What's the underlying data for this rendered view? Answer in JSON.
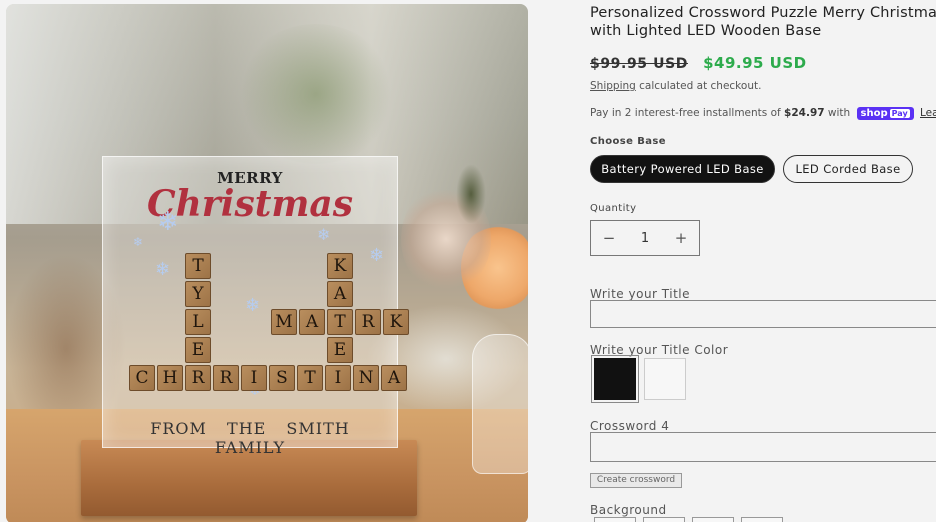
{
  "product": {
    "title_line1": "Personalized Crossword Puzzle Merry Christmas",
    "title_line2": "with Lighted LED Wooden Base",
    "price_regular": "$99.95 USD",
    "price_sale": "$49.95 USD",
    "shipping_link": "Shipping",
    "shipping_text": " calculated at checkout.",
    "installments_prefix": "Pay in 2 interest-free installments of ",
    "installments_amount": "$24.97",
    "installments_with": " with ",
    "shoppay_shop": "shop",
    "shoppay_pay": "Pay",
    "learn_more": "Learn more"
  },
  "options": {
    "base_label": "Choose Base",
    "base_options": [
      "Battery Powered LED Base",
      "LED Corded Base"
    ],
    "base_selected": "Battery Powered LED Base",
    "quantity_label": "Quantity",
    "quantity_value": "1",
    "quantity_minus": "−",
    "quantity_plus": "+",
    "title_label": "Write your Title",
    "title_color_label": "Write your Title Color",
    "title_colors": [
      "#111111",
      "#f7f7f7"
    ],
    "crossword_label": "Crossword 4",
    "create_button": "Create crossword",
    "background_label": "Background"
  },
  "image": {
    "merry": "MERRY",
    "christmas": "Christmas",
    "from_words": [
      "FROM",
      "THE",
      "SMITH",
      "FAMILY"
    ],
    "words": {
      "tyler": [
        "T",
        "Y",
        "L",
        "E",
        "R"
      ],
      "kate": [
        "K",
        "A",
        "T",
        "E"
      ],
      "mark": [
        "M",
        "A",
        "R",
        "K"
      ],
      "christina": [
        "C",
        "H",
        "R",
        "I",
        "S",
        "T",
        "I",
        "N",
        "A"
      ]
    }
  }
}
